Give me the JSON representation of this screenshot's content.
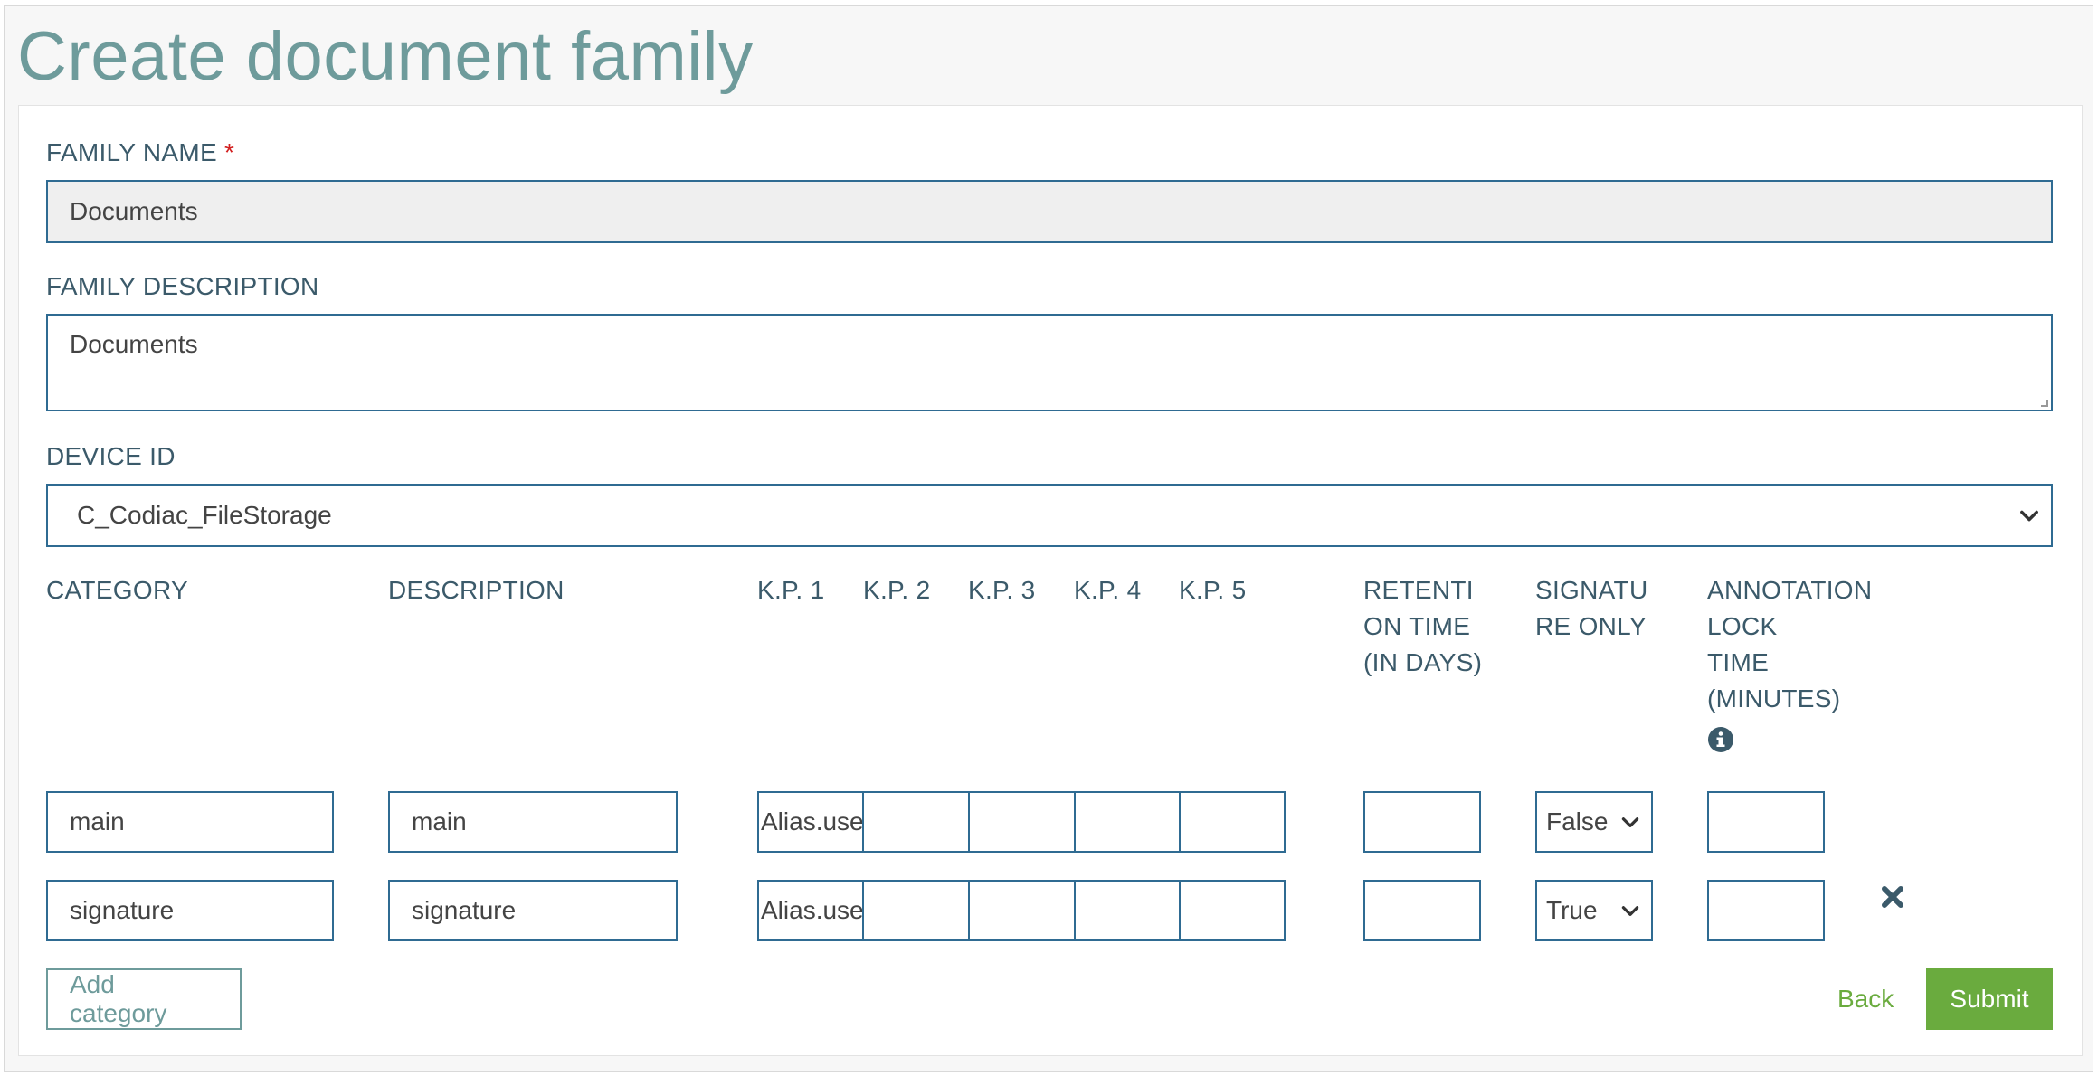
{
  "page": {
    "title": "Create document family"
  },
  "form": {
    "family_name": {
      "label": "FAMILY NAME",
      "required_mark": "*",
      "value": "Documents"
    },
    "family_description": {
      "label": "FAMILY DESCRIPTION",
      "value": "Documents"
    },
    "device_id": {
      "label": "DEVICE ID",
      "selected": "C_Codiac_FileStorage"
    }
  },
  "categories_table": {
    "headers": {
      "category": "CATEGORY",
      "description": "DESCRIPTION",
      "kp1": "K.P. 1",
      "kp2": "K.P. 2",
      "kp3": "K.P. 3",
      "kp4": "K.P. 4",
      "kp5": "K.P. 5",
      "retention": "RETENTI\nON TIME\n(IN DAYS)",
      "signature_only": "SIGNATU\nRE ONLY",
      "annotation_lock": "ANNOTATION\nLOCK\nTIME\n(MINUTES)"
    },
    "info_icon": "info-circle-icon",
    "rows": [
      {
        "category": "main",
        "description": "main",
        "kp1": "Alias.user",
        "kp2": "",
        "kp3": "",
        "kp4": "",
        "kp5": "",
        "retention": "",
        "signature_only": "False",
        "annotation_lock": ""
      },
      {
        "category": "signature",
        "description": "signature",
        "kp1": "Alias.user",
        "kp2": "",
        "kp3": "",
        "kp4": "",
        "kp5": "",
        "retention": "",
        "signature_only": "True",
        "annotation_lock": "",
        "delete_icon": "close-x-icon"
      }
    ]
  },
  "actions": {
    "add_category": "Add category",
    "back": "Back",
    "submit": "Submit"
  },
  "colors": {
    "title": "#6e9b9b",
    "label": "#3b5a6a",
    "input_border": "#2f6b92",
    "required": "#d21f1f",
    "submit_bg": "#6aab3e"
  }
}
